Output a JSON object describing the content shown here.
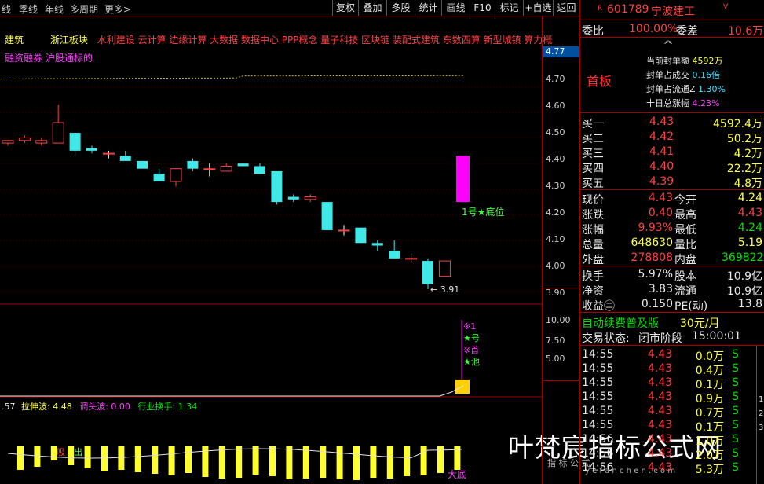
{
  "toolbar": {
    "left_items": [
      "线",
      "季线",
      "年线",
      "多周期",
      "更多>"
    ],
    "right_items": [
      "复权",
      "叠加",
      "多股",
      "统计",
      "画线",
      "F10",
      "标记",
      "+自选",
      "返回"
    ]
  },
  "header": {
    "sector": "建筑",
    "region_block": "浙江板块",
    "concepts": "水利建设 云计算 边缘计算 大数据 数据中心 PPP概念 量子科技 区块链 装配式建筑 东数西算 新型城镇 算力概",
    "tags": "融资融券 沪股通标的"
  },
  "main_chart": {
    "current_price_label": "4.77",
    "low_marker": "3.91",
    "signal_label": "1号★底位"
  },
  "price_axis": [
    "4.70",
    "4.60",
    "4.50",
    "4.40",
    "4.30",
    "4.20",
    "4.10",
    "4.00",
    "3.90"
  ],
  "vol_axis": [
    "10.00",
    "7.50",
    "5.00"
  ],
  "chart_data": {
    "type": "candlestick",
    "ylim": [
      3.87,
      4.79
    ],
    "candles": [
      [
        4.48,
        4.49,
        4.47,
        4.49
      ],
      [
        4.49,
        4.51,
        4.48,
        4.5
      ],
      [
        4.48,
        4.5,
        4.47,
        4.49
      ],
      [
        4.48,
        4.63,
        4.48,
        4.56
      ],
      [
        4.52,
        4.52,
        4.43,
        4.45
      ],
      [
        4.46,
        4.47,
        4.44,
        4.45
      ],
      [
        4.44,
        4.45,
        4.42,
        4.44
      ],
      [
        4.43,
        4.45,
        4.42,
        4.41
      ],
      [
        4.41,
        4.41,
        4.38,
        4.38
      ],
      [
        4.36,
        4.38,
        4.34,
        4.33
      ],
      [
        4.33,
        4.37,
        4.31,
        4.38
      ],
      [
        4.41,
        4.42,
        4.37,
        4.38
      ],
      [
        4.38,
        4.4,
        4.35,
        4.38
      ],
      [
        4.37,
        4.4,
        4.37,
        4.39
      ],
      [
        4.4,
        4.4,
        4.39,
        4.39
      ],
      [
        4.39,
        4.4,
        4.36,
        4.36
      ],
      [
        4.37,
        4.37,
        4.24,
        4.25
      ],
      [
        4.27,
        4.28,
        4.25,
        4.26
      ],
      [
        4.26,
        4.28,
        4.25,
        4.27
      ],
      [
        4.25,
        4.25,
        4.14,
        4.14
      ],
      [
        4.14,
        4.16,
        4.12,
        4.14
      ],
      [
        4.15,
        4.15,
        4.09,
        4.09
      ],
      [
        4.09,
        4.1,
        4.06,
        4.08
      ],
      [
        4.06,
        4.1,
        4.03,
        4.03
      ],
      [
        4.03,
        4.05,
        4.01,
        4.03
      ],
      [
        4.02,
        4.03,
        3.91,
        3.93
      ],
      [
        3.96,
        4.02,
        3.96,
        4.02
      ]
    ],
    "signal_bar": [
      4.25,
      4.43
    ]
  },
  "indicator": {
    "val_prefix": ".57",
    "l1": "拉伸波: 4.48",
    "l2": "调头波: 0.00",
    "l3": "行业换手: 1.34",
    "buy_mark": "吸",
    "sell_mark": "出",
    "bottom_mark": "大底",
    "bars": [
      30,
      26,
      18,
      24,
      28,
      32,
      30,
      33,
      35,
      37,
      34,
      39,
      41,
      40,
      36,
      38,
      42,
      41,
      40,
      42,
      43,
      40,
      41,
      38,
      37,
      34,
      30
    ],
    "signal_notes": [
      "※1",
      "★号",
      "※首",
      "★池"
    ]
  },
  "watermark": "叶梵宸指标公式网",
  "watermark_url": "y e f a n c h e n . c o m",
  "watermark_sub": "指  标  公  式",
  "stock": {
    "code": "601789",
    "name": "宁波建工",
    "prefix": "R",
    "suffix": "V"
  },
  "order": {
    "weibi_label": "委比",
    "weibi": "100.00%",
    "weicha_label": "委差",
    "weicha": "10.6万",
    "board": "首板",
    "seal_amount_label": "当前封单额",
    "seal_amount": "4592万",
    "seal_trade_label": "封单占成交",
    "seal_trade": "0.16倍",
    "seal_float_label": "封单占流通Z",
    "seal_float": "1.30%",
    "ten_day_label": "十日总涨幅",
    "ten_day": "4.23%"
  },
  "bids": [
    {
      "label": "买一",
      "price": "4.43",
      "vol": "4592.4万"
    },
    {
      "label": "买二",
      "price": "4.42",
      "vol": "50.2万"
    },
    {
      "label": "买三",
      "price": "4.41",
      "vol": "4.2万"
    },
    {
      "label": "买四",
      "price": "4.40",
      "vol": "22.2万"
    },
    {
      "label": "买五",
      "price": "4.39",
      "vol": "4.8万"
    }
  ],
  "quote": [
    {
      "l1": "现价",
      "v1": "4.43",
      "l2": "今开",
      "v2": "4.24"
    },
    {
      "l1": "涨跌",
      "v1": "0.40",
      "l2": "最高",
      "v2": "4.43"
    },
    {
      "l1": "涨幅",
      "v1": "9.93%",
      "l2": "最低",
      "v2": "4.24"
    },
    {
      "l1": "总量",
      "v1": "648630",
      "l2": "量比",
      "v2": "5.19"
    },
    {
      "l1": "外盘",
      "v1": "278808",
      "l2": "内盘",
      "v2": "369822"
    }
  ],
  "fin": [
    {
      "l1": "换手",
      "v1": "5.97%",
      "l2": "股本",
      "v2": "10.9亿"
    },
    {
      "l1": "净资",
      "v1": "3.83",
      "l2": "流通",
      "v2": "10.9亿"
    },
    {
      "l1": "收益㊁",
      "v1": "0.150",
      "l2": "PE(动)",
      "v2": "13.8"
    }
  ],
  "promo": {
    "text": "自动续费普及版",
    "price": "30元/月"
  },
  "trade_status": {
    "label": "交易状态:",
    "value": "闭市阶段",
    "time": "15:00:01"
  },
  "ticks": [
    {
      "t": "14:55",
      "p": "4.43",
      "v": "0.0万",
      "d": "S"
    },
    {
      "t": "14:55",
      "p": "4.43",
      "v": "0.4万",
      "d": "S"
    },
    {
      "t": "14:55",
      "p": "4.43",
      "v": "0.1万",
      "d": "S"
    },
    {
      "t": "14:55",
      "p": "4.43",
      "v": "0.9万",
      "d": "S"
    },
    {
      "t": "14:55",
      "p": "4.43",
      "v": "0.7万",
      "d": "S"
    },
    {
      "t": "14:55",
      "p": "4.43",
      "v": "0.1万",
      "d": "S"
    },
    {
      "t": "14:56",
      "p": "4.43",
      "v": "1.0万",
      "d": "S"
    },
    {
      "t": "14:56",
      "p": "4.43",
      "v": "2.0万",
      "d": "S"
    },
    {
      "t": "14:56",
      "p": "4.43",
      "v": "5.3万",
      "d": "S"
    }
  ],
  "tick_side": [
    "1",
    "2",
    "3"
  ]
}
